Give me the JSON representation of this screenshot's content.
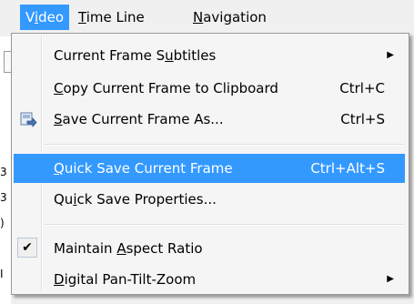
{
  "menubar": {
    "items": [
      {
        "pre": "V",
        "acc": "i",
        "post": "deo",
        "active": true
      },
      {
        "pre": "",
        "acc": "T",
        "post": "ime Line",
        "active": false
      },
      {
        "pre": "",
        "acc": "N",
        "post": "avigation",
        "active": false
      }
    ]
  },
  "menu": {
    "items": [
      {
        "pre": "Current Frame S",
        "acc": "u",
        "post": "btitles",
        "shortcut": "",
        "submenu": true,
        "icon": "",
        "checked": false
      },
      {
        "pre": "",
        "acc": "C",
        "post": "opy Current Frame to Clipboard",
        "shortcut": "Ctrl+C",
        "submenu": false,
        "icon": "",
        "checked": false
      },
      {
        "pre": "",
        "acc": "S",
        "post": "ave Current Frame As...",
        "shortcut": "Ctrl+S",
        "submenu": false,
        "icon": "save-frame-icon",
        "checked": false
      },
      {
        "pre": "",
        "acc": "Q",
        "post": "uick Save Current Frame",
        "shortcut": "Ctrl+Alt+S",
        "submenu": false,
        "icon": "",
        "checked": false,
        "highlighted": true
      },
      {
        "pre": "Qu",
        "acc": "i",
        "post": "ck Save Properties...",
        "shortcut": "",
        "submenu": false,
        "icon": "",
        "checked": false
      },
      {
        "pre": "Maintain ",
        "acc": "A",
        "post": "spect Ratio",
        "shortcut": "",
        "submenu": false,
        "icon": "",
        "checked": true
      },
      {
        "pre": "",
        "acc": "D",
        "post": "igital Pan-Tilt-Zoom",
        "shortcut": "",
        "submenu": true,
        "icon": "",
        "checked": false
      }
    ],
    "check_glyph": "✔",
    "submenu_glyph": "▶"
  },
  "background": {
    "fragments": [
      "3",
      "3",
      ")",
      "I"
    ]
  },
  "colors": {
    "highlight": "#3399ff",
    "menu_bg": "#f5f5f5"
  }
}
